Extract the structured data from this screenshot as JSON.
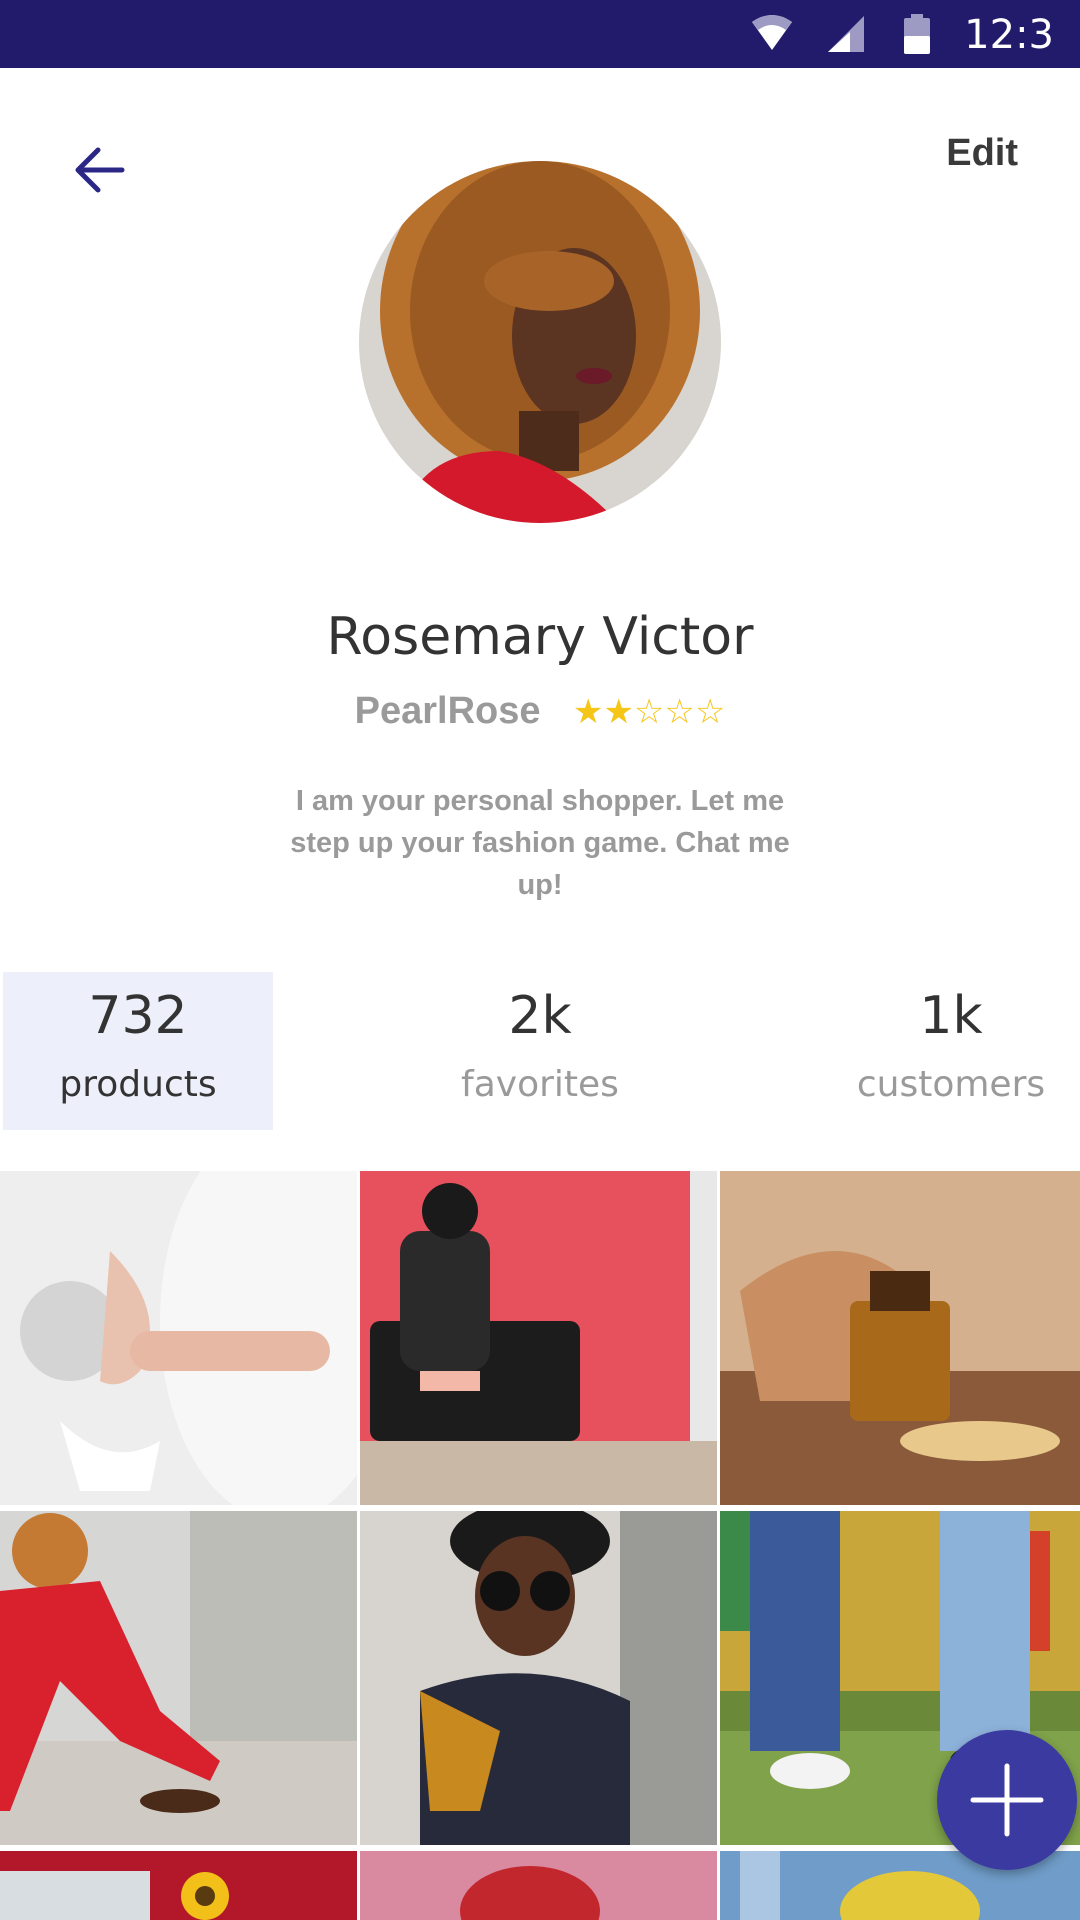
{
  "status_bar": {
    "time": "12:3"
  },
  "header": {
    "edit_label": "Edit"
  },
  "profile": {
    "name": "Rosemary Victor",
    "username": "PearlRose",
    "rating": 2,
    "rating_max": 5,
    "stars_display": "★★☆☆☆",
    "bio": "I am your personal shopper. Let me step up your fashion game. Chat me up!"
  },
  "stats": [
    {
      "value": "732",
      "label": "products"
    },
    {
      "value": "2k",
      "label": "favorites"
    },
    {
      "value": "1k",
      "label": "customers"
    }
  ],
  "colors": {
    "status_bar": "#221b6b",
    "accent": "#3b3aa1",
    "star": "#f5c518",
    "active_tab": "#edf0fa"
  },
  "grid": {
    "items": [
      "wedding-dress-photo",
      "woman-on-sofa-photo",
      "perfume-sandals-photo",
      "woman-red-suit-photo",
      "woman-sunglasses-photo",
      "sneakers-jeans-photo",
      "sunflower-photo",
      "headscarf-photo",
      "yellow-dress-photo"
    ]
  },
  "fab": {
    "icon": "plus-icon"
  }
}
